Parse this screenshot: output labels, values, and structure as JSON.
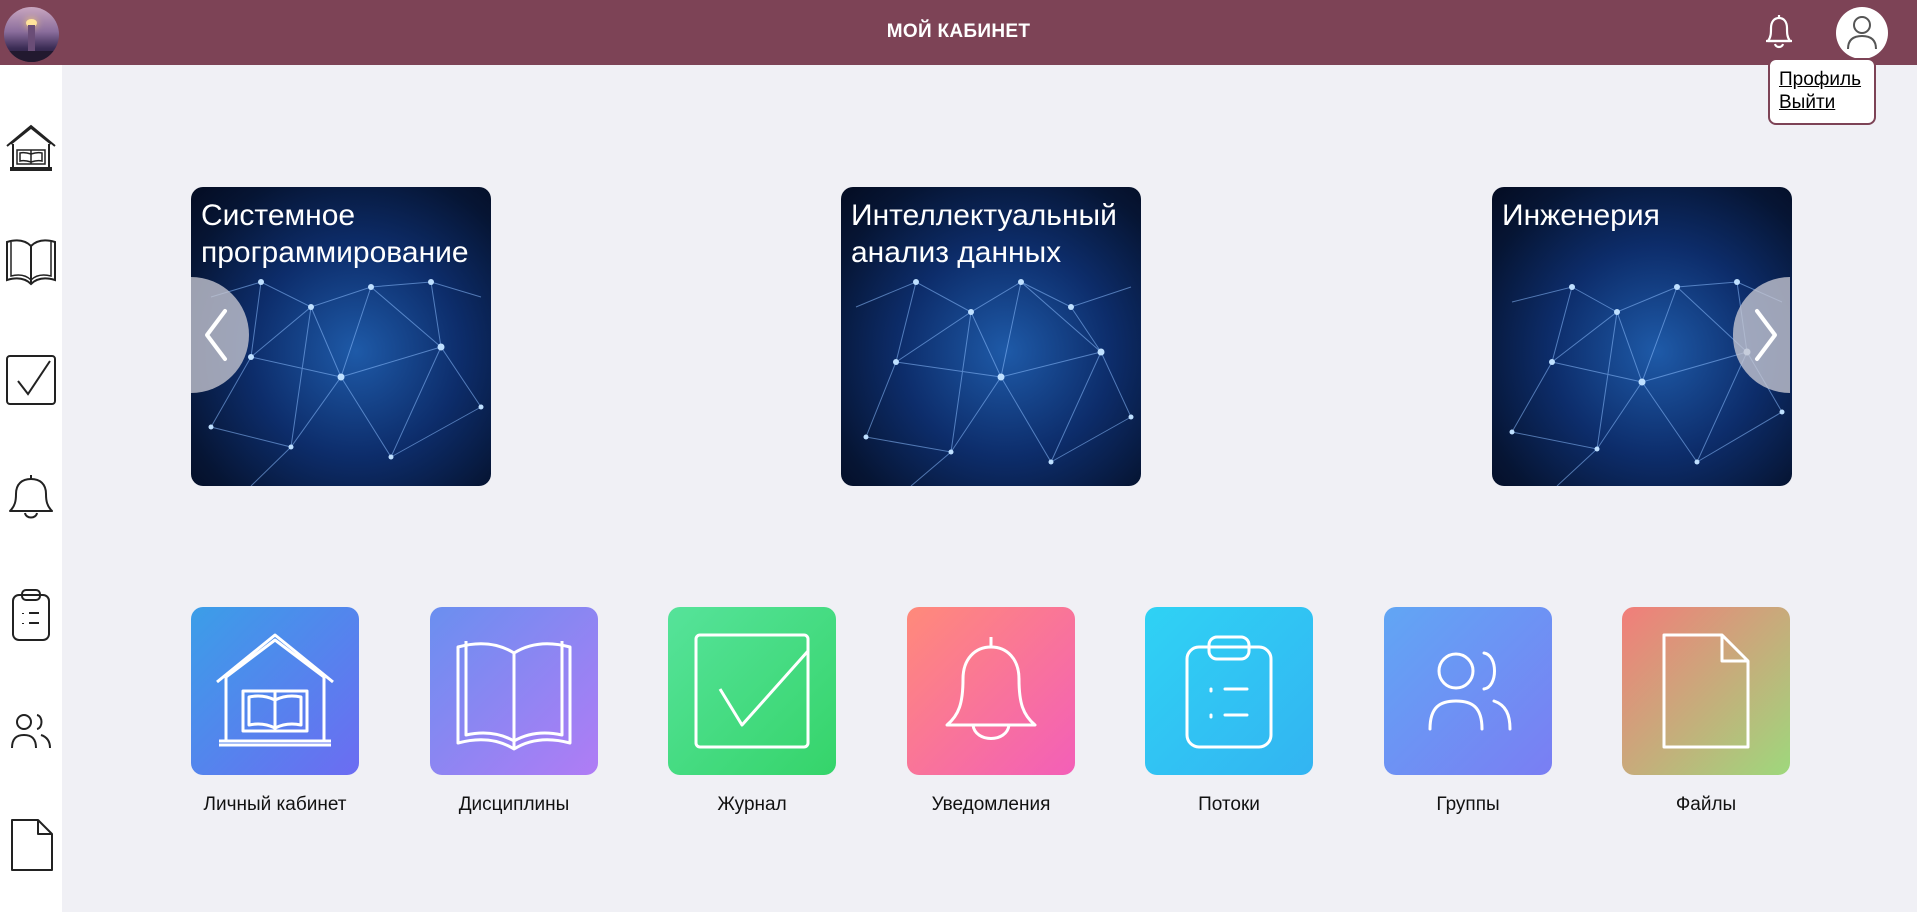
{
  "header": {
    "title": "МОЙ КАБИНЕТ",
    "logo_icon": "lighthouse-logo",
    "notifications_icon": "bell-icon",
    "avatar_icon": "user-avatar-icon",
    "color": "#7d4356"
  },
  "profile_menu": {
    "items": [
      "Профиль",
      "Выйти"
    ]
  },
  "sidebar": {
    "items": [
      "home-book-icon",
      "book-icon",
      "checkbox-icon",
      "bell-icon",
      "clipboard-icon",
      "users-icon",
      "file-icon"
    ]
  },
  "carousel": {
    "cards": [
      {
        "title": "Системное программирование"
      },
      {
        "title": "Интеллектуальный анализ данных"
      },
      {
        "title": "Инженерия"
      }
    ],
    "prev_icon": "chevron-left-icon",
    "next_icon": "chevron-right-icon"
  },
  "tiles": [
    {
      "label": "Личный кабинет",
      "icon": "home-book-icon",
      "colors": [
        "#3b9ee8",
        "#6c6cf2"
      ]
    },
    {
      "label": "Дисциплины",
      "icon": "book-icon",
      "colors": [
        "#6a8ff0",
        "#b07cf5"
      ]
    },
    {
      "label": "Журнал",
      "icon": "checkbox-icon",
      "colors": [
        "#56e39a",
        "#35d46a"
      ]
    },
    {
      "label": "Уведомления",
      "icon": "bell-icon",
      "colors": [
        "#ff8a7a",
        "#f35fb8"
      ]
    },
    {
      "label": "Потоки",
      "icon": "clipboard-icon",
      "colors": [
        "#2fd2f4",
        "#33b4f2"
      ]
    },
    {
      "label": "Группы",
      "icon": "users-icon",
      "colors": [
        "#61a6f4",
        "#7a7ef3"
      ]
    },
    {
      "label": "Файлы",
      "icon": "file-icon",
      "colors": [
        "#f27d7a",
        "#9ed87c"
      ]
    }
  ]
}
